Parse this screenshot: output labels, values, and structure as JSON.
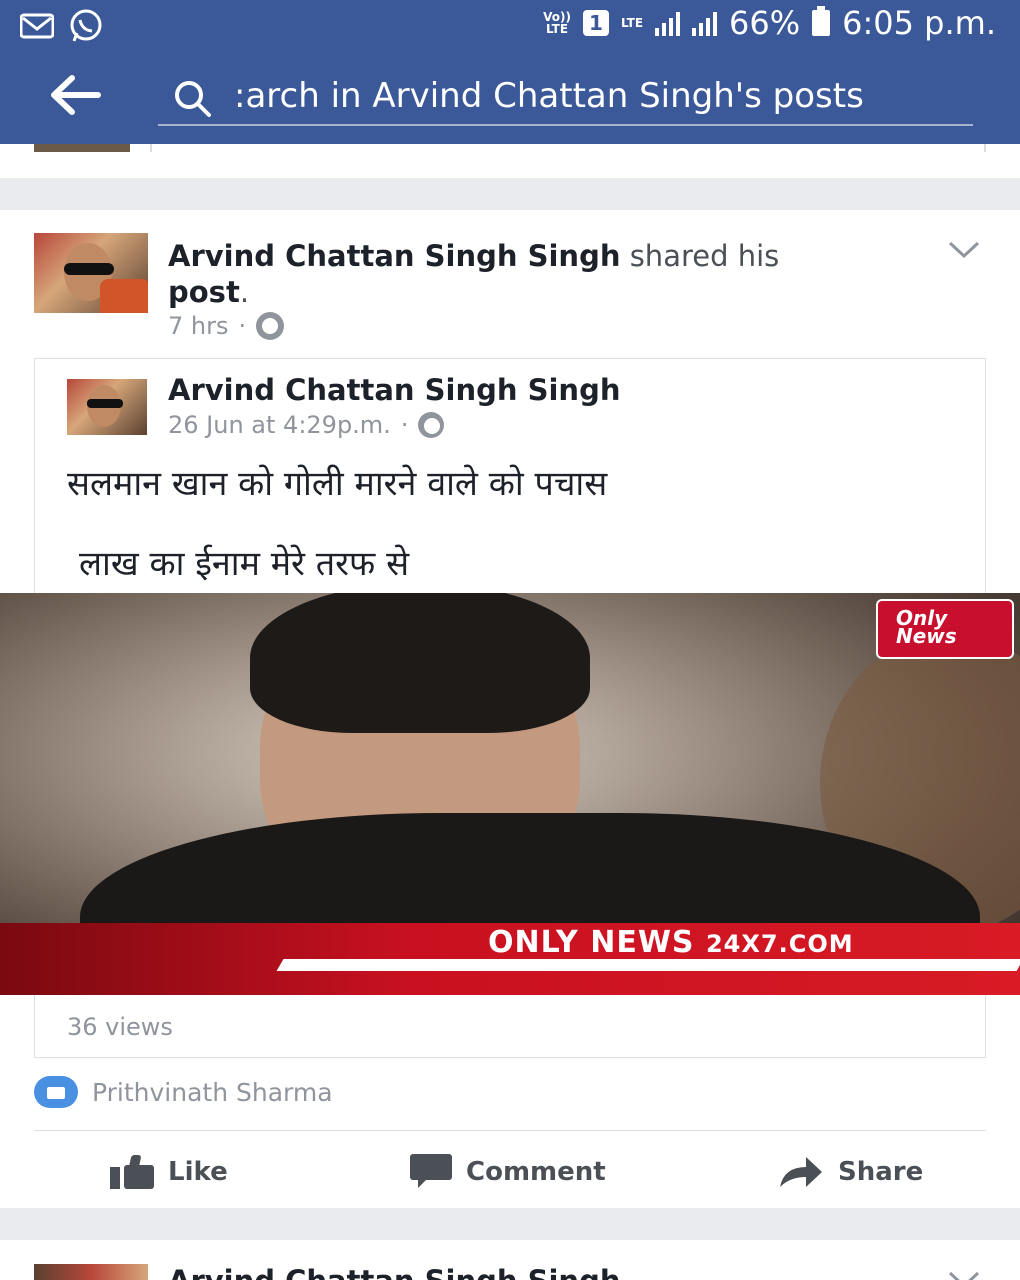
{
  "status_bar": {
    "volte": "Vo))\nLTE",
    "sim": "1",
    "lte": "LTE",
    "battery": "66%",
    "time": "6:05 p.m."
  },
  "header": {
    "search_text": ":arch in Arvind Chattan Singh's posts"
  },
  "post": {
    "author": "Arvind Chattan Singh Singh",
    "action_text": "shared his",
    "object_text": "post",
    "time": "7 hrs",
    "separator": "·",
    "shared": {
      "author": "Arvind Chattan Singh Singh",
      "time": "26 Jun at 4:29p.m.",
      "separator": "·",
      "text_line1": "सलमान खान को गोली मारने वाले को पचास",
      "text_line2": "लाख का ईनाम मेरे तरफ से",
      "video": {
        "logo_line1": "Only",
        "logo_line2": "News",
        "caption_main": "ONLY NEWS",
        "caption_domain": "24X7.COM"
      },
      "views": "36 views"
    },
    "reaction_name": "Prithvinath Sharma",
    "actions": {
      "like": "Like",
      "comment": "Comment",
      "share": "Share"
    }
  },
  "next_post": {
    "author": "Arvind Chattan Singh Singh"
  },
  "colors": {
    "facebook_blue": "#3b5998",
    "like_blue": "#4a90e2",
    "news_red": "#c8102e"
  }
}
